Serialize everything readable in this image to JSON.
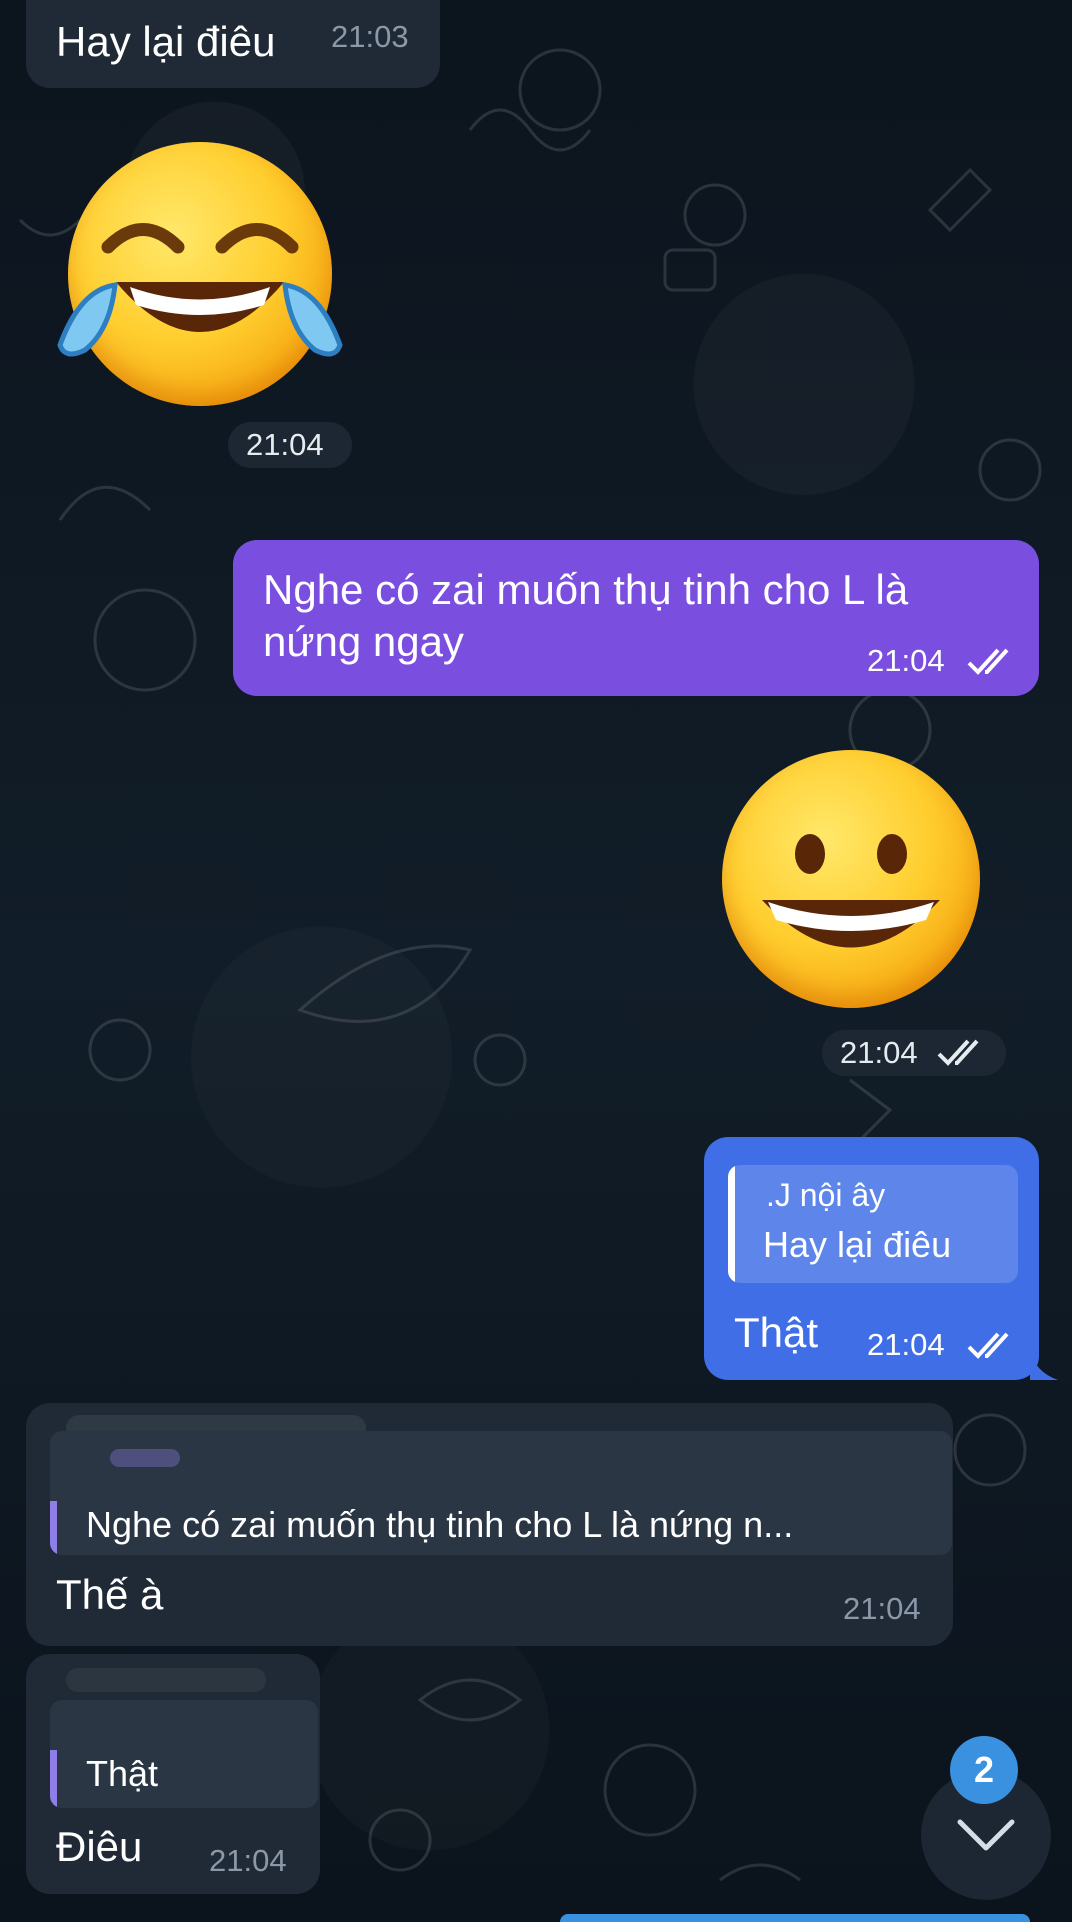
{
  "messages": {
    "m1": {
      "text": "Hay lại điêu",
      "time": "21:03"
    },
    "m2": {
      "emoji": "face-with-tears-of-joy",
      "time": "21:04"
    },
    "m3": {
      "line1": "Nghe có zai muốn thụ tinh cho L là",
      "line2": "nứng ngay",
      "time": "21:04"
    },
    "m4": {
      "emoji": "grinning-face",
      "time": "21:04"
    },
    "m5": {
      "reply_sender": ".J nội ây",
      "reply_text": "Hay lại điêu",
      "text": "Thật",
      "time": "21:04"
    },
    "m6": {
      "reply_text": "Nghe có zai muốn thụ tinh cho L là nứng n...",
      "text": "Thế à",
      "time": "21:04"
    },
    "m7": {
      "reply_text": "Thật",
      "text": "Điêu",
      "time": "21:04"
    }
  },
  "scroll_button": {
    "unread_count": "2",
    "icon": "chevron-down-icon"
  },
  "colors": {
    "background": "#0f1a24",
    "incoming_bubble": "#1f2a36",
    "outgoing_purple": "#7a4fe0",
    "outgoing_blue": "#3f6ee6",
    "accent": "#3a91e0",
    "reply_bar": "#8f7ee8"
  }
}
